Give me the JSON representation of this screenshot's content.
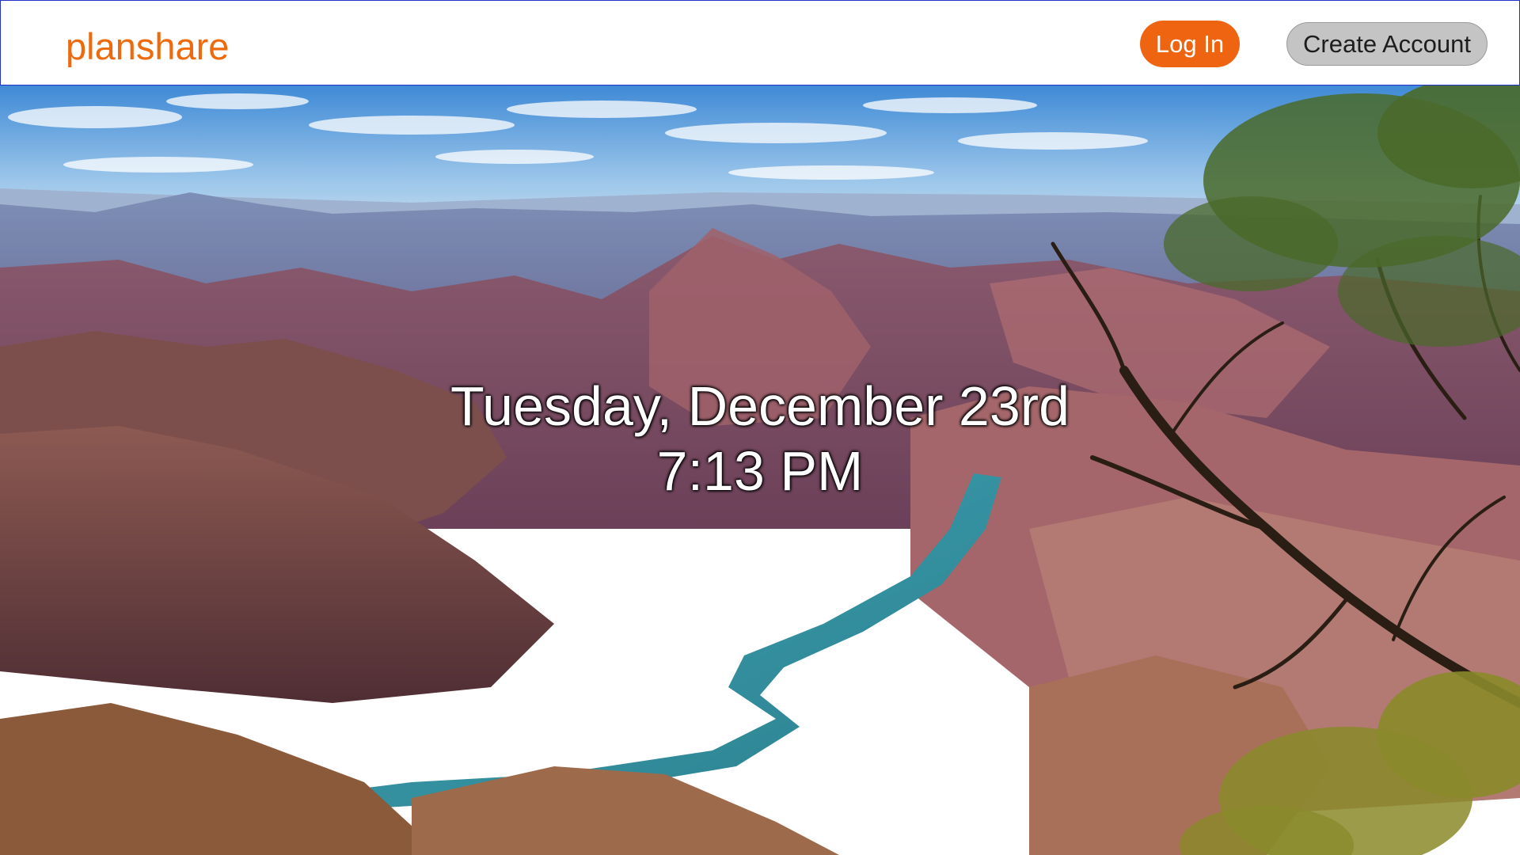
{
  "header": {
    "brand": "planshare",
    "login_label": "Log In",
    "create_account_label": "Create Account"
  },
  "hero": {
    "date": "Tuesday, December 23rd",
    "time": "7:13 PM",
    "background_scene": "canyon-landscape-photo"
  },
  "colors": {
    "brand": "#ee6a0e",
    "login_button": "#ef6411",
    "create_button": "#c4c4c4"
  }
}
